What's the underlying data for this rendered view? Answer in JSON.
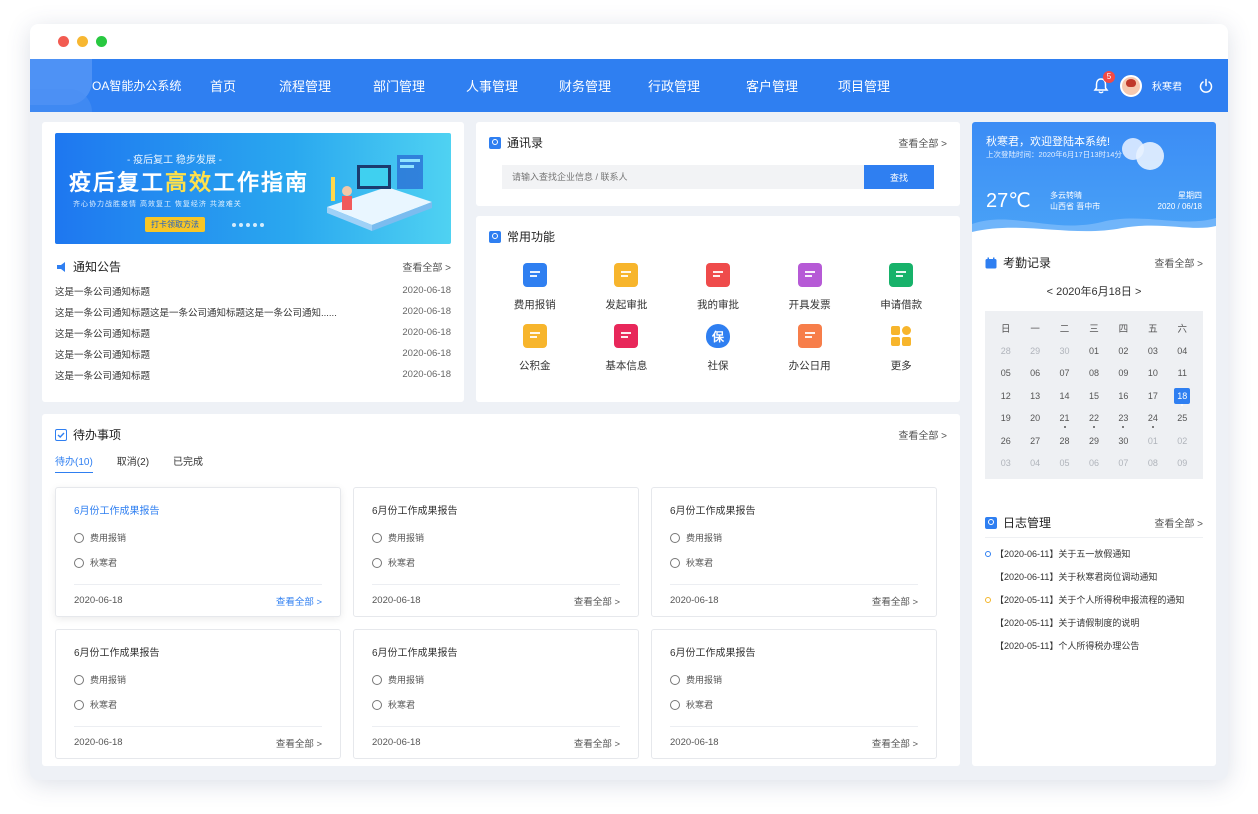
{
  "nav": {
    "title": "OA智能办公系统",
    "items": [
      "首页",
      "流程管理",
      "部门管理",
      "人事管理",
      "财务管理",
      "行政管理",
      "客户管理",
      "项目管理"
    ],
    "badge": "5",
    "username": "秋寒君"
  },
  "banner": {
    "subtitle": "- 疫后复工 稳步发展 -",
    "headline_a": "疫后复工",
    "headline_b": "高效",
    "headline_c": "工作指南",
    "slogan": "齐心协力战胜疫情 高效复工 恢复经济 共渡难关",
    "button": "打卡领取方法"
  },
  "notice": {
    "title": "通知公告",
    "more": "查看全部 >",
    "rows": [
      {
        "text": "这是一条公司通知标题",
        "date": "2020-06-18"
      },
      {
        "text": "这是一条公司通知标题这是一条公司通知标题这是一条公司通知......",
        "date": "2020-06-18"
      },
      {
        "text": "这是一条公司通知标题",
        "date": "2020-06-18"
      },
      {
        "text": "这是一条公司通知标题",
        "date": "2020-06-18"
      },
      {
        "text": "这是一条公司通知标题",
        "date": "2020-06-18"
      }
    ]
  },
  "contacts": {
    "title": "通讯录",
    "more": "查看全部 >",
    "placeholder": "请输入查找企业信息 / 联系人",
    "button": "查找"
  },
  "functions": {
    "title": "常用功能",
    "items": [
      {
        "label": "费用报销",
        "color": "#2f7ff1",
        "icon": "expense-icon"
      },
      {
        "label": "发起审批",
        "color": "#f7b52c",
        "icon": "approval-icon"
      },
      {
        "label": "我的审批",
        "color": "#ef4b4b",
        "icon": "my-approval-icon"
      },
      {
        "label": "开具发票",
        "color": "#b65ad6",
        "icon": "invoice-icon"
      },
      {
        "label": "申请借款",
        "color": "#17b26a",
        "icon": "loan-icon"
      },
      {
        "label": "公积金",
        "color": "#f7b52c",
        "icon": "fund-icon"
      },
      {
        "label": "基本信息",
        "color": "#e8275a",
        "icon": "info-icon"
      },
      {
        "label": "社保",
        "color": "#2f7ff1",
        "icon": "social-security-icon"
      },
      {
        "label": "办公日用",
        "color": "#f77e4a",
        "icon": "office-supplies-icon"
      },
      {
        "label": "更多",
        "color": "#f7b52c",
        "icon": "more-icon"
      }
    ],
    "social_glyph": "保"
  },
  "todo": {
    "title": "待办事项",
    "more": "查看全部 >",
    "tabs": [
      "待办(10)",
      "取消(2)",
      "已完成"
    ],
    "cards": [
      {
        "title": "6月份工作成果报告",
        "type": "费用报销",
        "user": "秋寒君",
        "date": "2020-06-18",
        "link": "查看全部 >"
      },
      {
        "title": "6月份工作成果报告",
        "type": "费用报销",
        "user": "秋寒君",
        "date": "2020-06-18",
        "link": "查看全部 >"
      },
      {
        "title": "6月份工作成果报告",
        "type": "费用报销",
        "user": "秋寒君",
        "date": "2020-06-18",
        "link": "查看全部 >"
      },
      {
        "title": "6月份工作成果报告",
        "type": "费用报销",
        "user": "秋寒君",
        "date": "2020-06-18",
        "link": "查看全部 >"
      },
      {
        "title": "6月份工作成果报告",
        "type": "费用报销",
        "user": "秋寒君",
        "date": "2020-06-18",
        "link": "查看全部 >"
      },
      {
        "title": "6月份工作成果报告",
        "type": "费用报销",
        "user": "秋寒君",
        "date": "2020-06-18",
        "link": "查看全部 >"
      }
    ]
  },
  "welcome": {
    "title": "秋寒君，欢迎登陆本系统!",
    "last_login": "上次登陆时间：2020年6月17日13时14分",
    "temperature": "27℃",
    "weather": "多云转晴",
    "location": "山西省 晋中市",
    "weekday": "星期四",
    "date": "2020 / 06/18"
  },
  "attendance": {
    "title": "考勤记录",
    "more": "查看全部 >",
    "month": "< 2020年6月18日 >",
    "weekdays": [
      "日",
      "一",
      "二",
      "三",
      "四",
      "五",
      "六"
    ],
    "weeks": [
      [
        {
          "d": "28",
          "m": true
        },
        {
          "d": "29",
          "m": true
        },
        {
          "d": "30",
          "m": true
        },
        {
          "d": "01"
        },
        {
          "d": "02"
        },
        {
          "d": "03"
        },
        {
          "d": "04"
        }
      ],
      [
        {
          "d": "05"
        },
        {
          "d": "06"
        },
        {
          "d": "07"
        },
        {
          "d": "08"
        },
        {
          "d": "09"
        },
        {
          "d": "10"
        },
        {
          "d": "11"
        }
      ],
      [
        {
          "d": "12"
        },
        {
          "d": "13"
        },
        {
          "d": "14"
        },
        {
          "d": "15"
        },
        {
          "d": "16"
        },
        {
          "d": "17"
        },
        {
          "d": "18",
          "sel": true
        }
      ],
      [
        {
          "d": "19"
        },
        {
          "d": "20"
        },
        {
          "d": "21",
          "mk": true
        },
        {
          "d": "22",
          "mk": true
        },
        {
          "d": "23",
          "mk": true
        },
        {
          "d": "24",
          "mk": true
        },
        {
          "d": "25"
        }
      ],
      [
        {
          "d": "26"
        },
        {
          "d": "27"
        },
        {
          "d": "28"
        },
        {
          "d": "29"
        },
        {
          "d": "30"
        },
        {
          "d": "01",
          "m": true
        },
        {
          "d": "02",
          "m": true
        }
      ],
      [
        {
          "d": "03",
          "m": true
        },
        {
          "d": "04",
          "m": true
        },
        {
          "d": "05",
          "m": true
        },
        {
          "d": "06",
          "m": true
        },
        {
          "d": "07",
          "m": true
        },
        {
          "d": "08",
          "m": true
        },
        {
          "d": "09",
          "m": true
        }
      ]
    ]
  },
  "logs": {
    "title": "日志管理",
    "more": "查看全部 >",
    "items": [
      {
        "text": "【2020-06-11】关于五一放假通知",
        "bullet": "blue"
      },
      {
        "text": "【2020-06-11】关于秋寒君岗位调动通知",
        "bullet": "none"
      },
      {
        "text": "【2020-05-11】关于个人所得税申报流程的通知",
        "bullet": "yellow"
      },
      {
        "text": "【2020-05-11】关于请假制度的说明",
        "bullet": "none"
      },
      {
        "text": "【2020-05-11】个人所得税办理公告",
        "bullet": "none"
      }
    ]
  },
  "colors": {
    "primary": "#2f7ff1",
    "nav": "#2f7ff1",
    "background": "#eef1f6"
  }
}
